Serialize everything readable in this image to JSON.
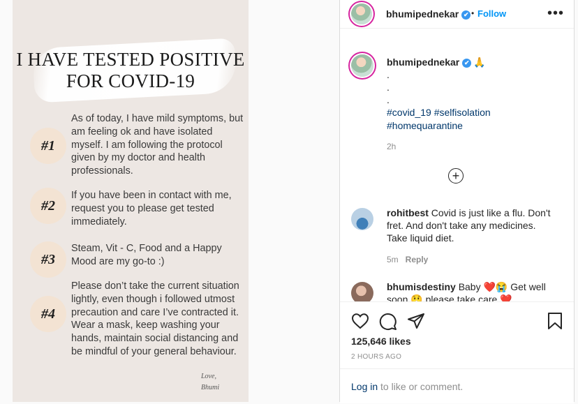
{
  "post_image": {
    "headline_line1": "I HAVE TESTED POSITIVE",
    "headline_line2": "FOR COVID-19",
    "points": [
      {
        "badge": "#1",
        "text": "As of today, I have mild symptoms, but am feeling ok and have isolated myself. I am following the protocol given by my doctor and health professionals."
      },
      {
        "badge": "#2",
        "text": "If you have been in contact with me, request you to please get tested immediately."
      },
      {
        "badge": "#3",
        "text": "Steam, Vit - C, Food and a Happy Mood are my go-to :)"
      },
      {
        "badge": "#4",
        "text": "Please don’t take the current situation lightly, even though i followed utmost precaution and care I’ve contracted it. Wear a mask, keep washing your hands, maintain social distancing and be mindful of your general behaviour."
      }
    ],
    "signoff_line1": "Love,",
    "signoff_line2": "Bhumi"
  },
  "header": {
    "username": "bhumipednekar",
    "separator": "•",
    "follow_label": "Follow",
    "more_label": "•••",
    "verified_mark": "✔"
  },
  "caption": {
    "username": "bhumipednekar",
    "emoji": "🙏",
    "dot_lines": [
      ".",
      ".",
      "."
    ],
    "hashtags_line1": "#covid_19 #selfisolation",
    "hashtags_line2": "#homequarantine",
    "time": "2h",
    "load_more": "+"
  },
  "comments": [
    {
      "username": "rohitbest",
      "text": "Covid is just like a flu. Don't fret. And don't take any medicines. Take liquid diet.",
      "time": "5m",
      "reply_label": "Reply"
    },
    {
      "username": "bhumisdestiny",
      "text_line1": "Baby ❤️😭 Get well",
      "text_line2": "soon 😲 please take care ❤️"
    }
  ],
  "actions": {
    "icons": [
      "heart-icon",
      "comment-icon",
      "share-icon",
      "bookmark-icon"
    ],
    "likes": "125,646 likes",
    "posted_ago": "2 HOURS AGO"
  },
  "login": {
    "link_label": "Log in",
    "rest": " to like or comment."
  },
  "colors": {
    "link_blue": "#0095f6",
    "hashtag_blue": "#00376b",
    "badge_bg": "#f3e3d3",
    "image_bg": "#ede7e3"
  }
}
